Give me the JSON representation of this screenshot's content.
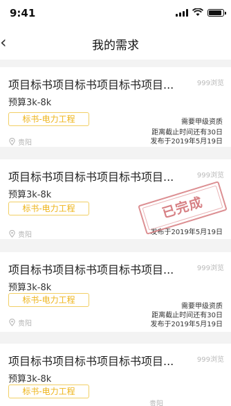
{
  "status_bar": {
    "time": "9:41",
    "battery_level": 0.9
  },
  "header": {
    "back_icon": "chevron-left-icon",
    "title": "我的需求"
  },
  "cards": [
    {
      "title": "项目标书项目标书项目标书项目...",
      "views": "999浏览",
      "budget": "预算3k-8k",
      "tag": "标书-电力工程",
      "location": "贵阳",
      "qualification": "需要甲级资质",
      "deadline": "距离截止时间还有30日",
      "published": "发布于2019年5月19日",
      "stamp": ""
    },
    {
      "title": "项目标书项目标书项目标书项目...",
      "views": "999浏览",
      "budget": "预算3k-8k",
      "tag": "标书-电力工程",
      "location": "贵阳",
      "qualification": "",
      "deadline": "",
      "published": "发布于2019年5月19日",
      "stamp": "已完成"
    },
    {
      "title": "项目标书项目标书项目标书项目...",
      "views": "999浏览",
      "budget": "预算3k-8k",
      "tag": "标书-电力工程",
      "location": "贵阳",
      "qualification": "需要甲级资质",
      "deadline": "距离截止时间还有30日",
      "published": "发布于2019年5月19日",
      "stamp": ""
    },
    {
      "title": "项目标书项目标书项目标书项目...",
      "views": "999浏览",
      "budget": "预算3k-8k",
      "tag": "标书-电力工程",
      "location": "贵阳",
      "qualification": "",
      "deadline": "",
      "published": "",
      "stamp": ""
    }
  ],
  "colors": {
    "accent": "#eeb41a",
    "tag_border": "#f1cf64",
    "stamp": "#d06a6f",
    "background": "#f3f3f3"
  }
}
